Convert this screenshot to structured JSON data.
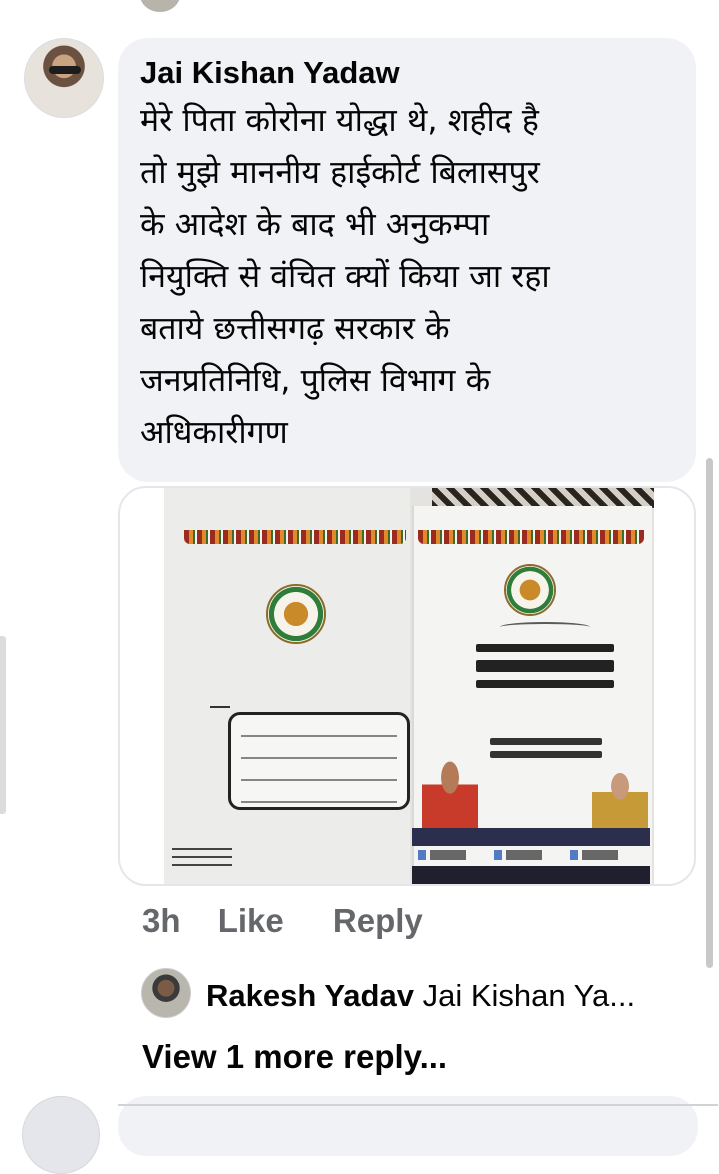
{
  "comment": {
    "author": "Jai Kishan Yadaw",
    "lines": [
      "मेरे पिता कोरोना योद्धा थे, शहीद है",
      "तो मुझे माननीय हाईकोर्ट बिलासपुर",
      "के आदेश के बाद भी अनुकम्पा",
      "नियुक्ति से वंचित क्यों किया जा रहा",
      "बताये छत्तीसगढ़ सरकार के",
      "जनप्रतिनिधि, पुलिस विभाग के",
      "अधिकारीगण"
    ],
    "timestamp": "3h",
    "like_label": "Like",
    "reply_label": "Reply"
  },
  "reply_preview": {
    "author": "Rakesh Yadav",
    "snippet": "Jai Kishan Ya..."
  },
  "view_more_label": "View 1 more reply..."
}
